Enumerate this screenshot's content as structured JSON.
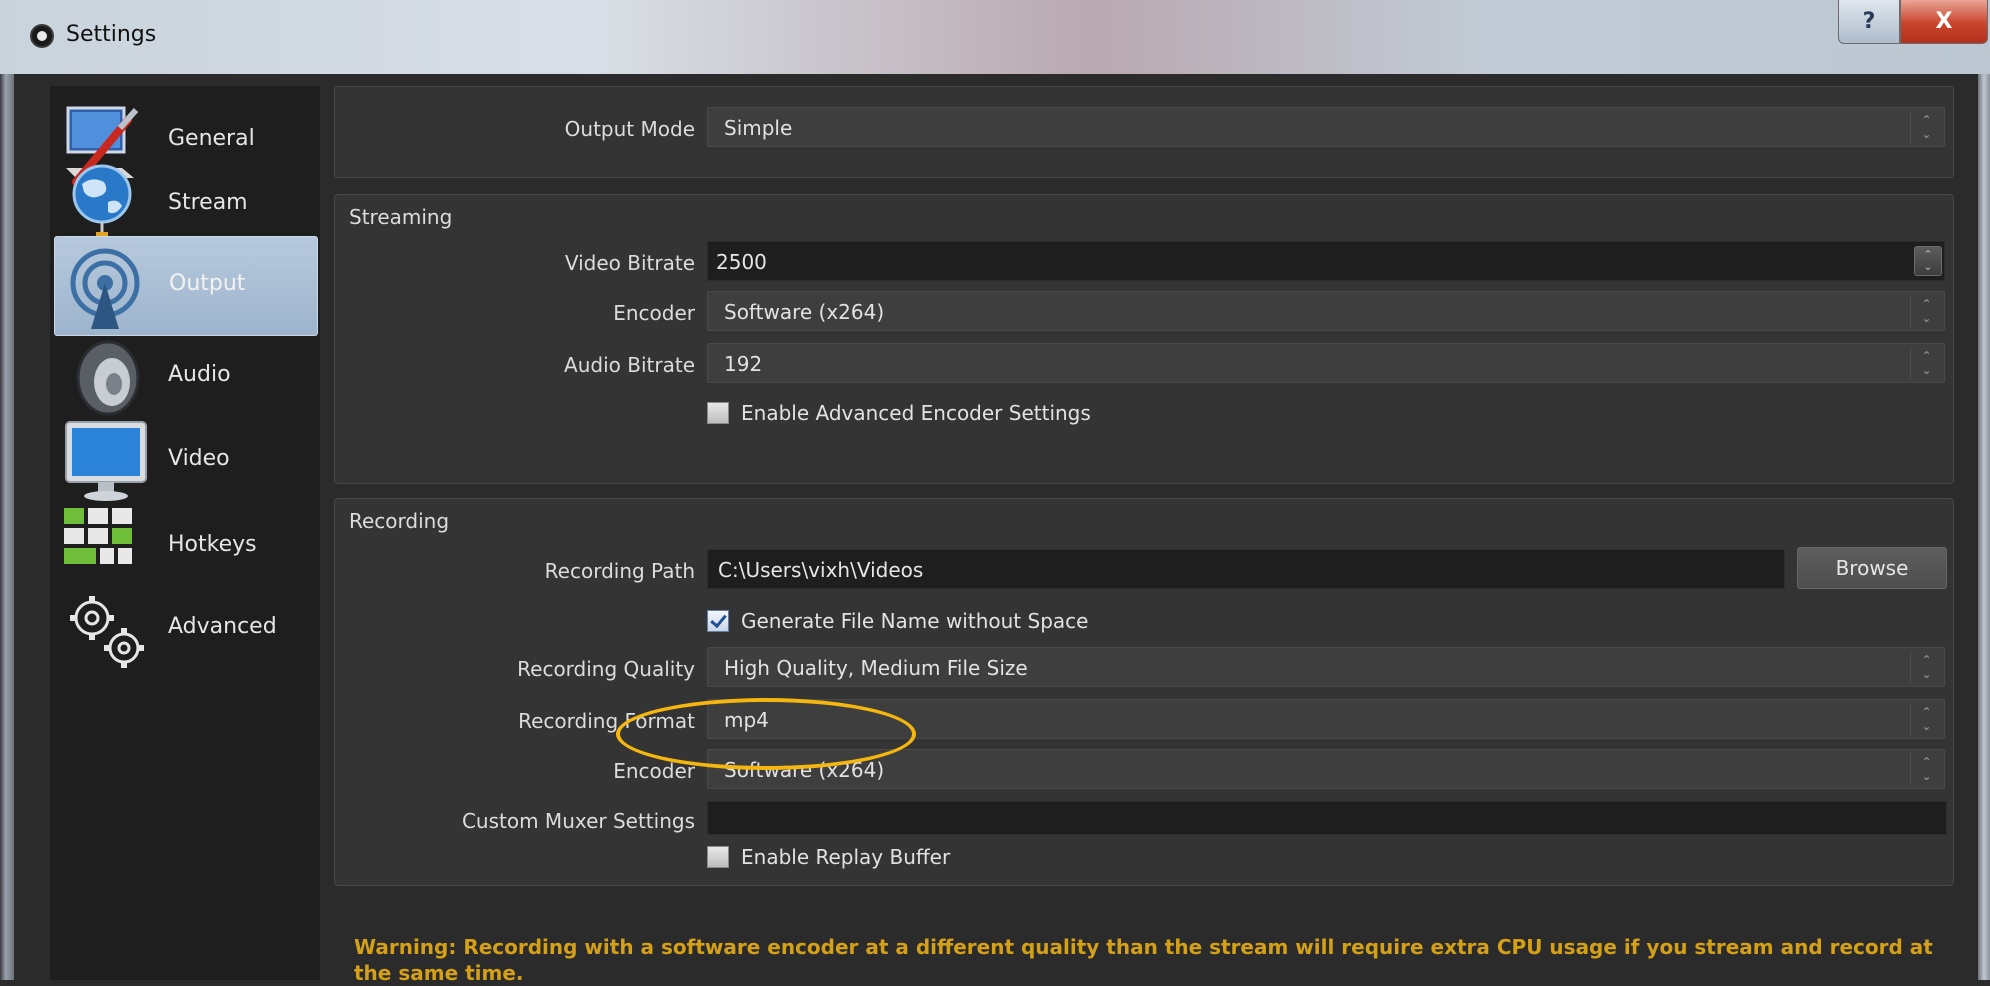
{
  "window": {
    "title": "Settings",
    "help_label": "?",
    "close_label": "X"
  },
  "sidebar": {
    "items": [
      {
        "label": "General",
        "icon": "general-icon",
        "active": false
      },
      {
        "label": "Stream",
        "icon": "globe-icon",
        "active": false
      },
      {
        "label": "Output",
        "icon": "broadcast-icon",
        "active": true
      },
      {
        "label": "Audio",
        "icon": "speaker-icon",
        "active": false
      },
      {
        "label": "Video",
        "icon": "monitor-icon",
        "active": false
      },
      {
        "label": "Hotkeys",
        "icon": "keyboard-icon",
        "active": false
      },
      {
        "label": "Advanced",
        "icon": "gears-icon",
        "active": false
      }
    ]
  },
  "output_mode": {
    "label": "Output Mode",
    "value": "Simple"
  },
  "streaming": {
    "title": "Streaming",
    "video_bitrate": {
      "label": "Video Bitrate",
      "value": "2500"
    },
    "encoder": {
      "label": "Encoder",
      "value": "Software (x264)"
    },
    "audio_bitrate": {
      "label": "Audio Bitrate",
      "value": "192"
    },
    "advanced_encoder": {
      "label": "Enable Advanced Encoder Settings",
      "checked": false
    }
  },
  "recording": {
    "title": "Recording",
    "path": {
      "label": "Recording Path",
      "value": "C:\\Users\\vixh\\Videos",
      "browse_label": "Browse"
    },
    "no_space": {
      "label": "Generate File Name without Space",
      "checked": true
    },
    "quality": {
      "label": "Recording Quality",
      "value": "High Quality, Medium File Size"
    },
    "format": {
      "label": "Recording Format",
      "value": "mp4"
    },
    "encoder": {
      "label": "Encoder",
      "value": "Software (x264)"
    },
    "muxer": {
      "label": "Custom Muxer Settings",
      "value": ""
    },
    "replay_buffer": {
      "label": "Enable Replay Buffer",
      "checked": false
    }
  },
  "warning": "Warning: Recording with a software encoder at a different quality than the stream will require extra CPU usage if you stream and record at the same time.",
  "colors": {
    "warning": "#d4a017",
    "highlight": "#f5b70f",
    "active_item": "#9db4cd"
  }
}
